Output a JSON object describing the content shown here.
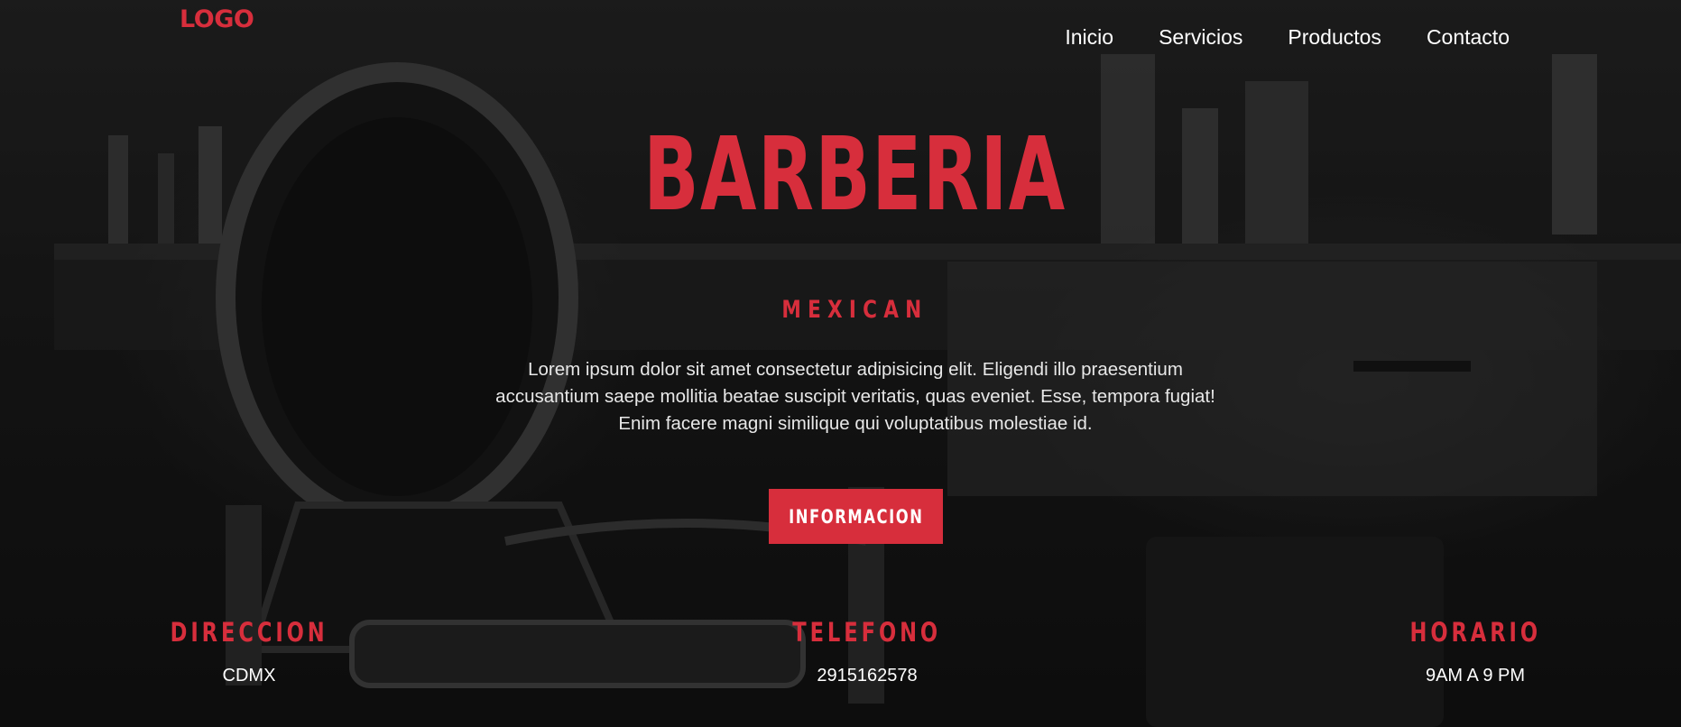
{
  "header": {
    "logo": "LOGO",
    "nav": [
      {
        "label": "Inicio"
      },
      {
        "label": "Servicios"
      },
      {
        "label": "Productos"
      },
      {
        "label": "Contacto"
      }
    ]
  },
  "hero": {
    "title": "BARBERIA",
    "subtitle": "MEXICAN",
    "description": "Lorem ipsum dolor sit amet consectetur adipisicing elit. Eligendi illo praesentium accusantium saepe mollitia beatae suscipit veritatis, quas eveniet. Esse, tempora fugiat! Enim facere magni similique qui voluptatibus molestiae id.",
    "button_label": "INFORMACION"
  },
  "info": [
    {
      "label": "DIRECCION",
      "value": "CDMX"
    },
    {
      "label": "TELEFONO",
      "value": "2915162578"
    },
    {
      "label": "HORARIO",
      "value": "9AM A 9 PM"
    }
  ],
  "colors": {
    "accent": "#d72e3c",
    "text": "#ffffff",
    "background": "#1a1a1a"
  }
}
